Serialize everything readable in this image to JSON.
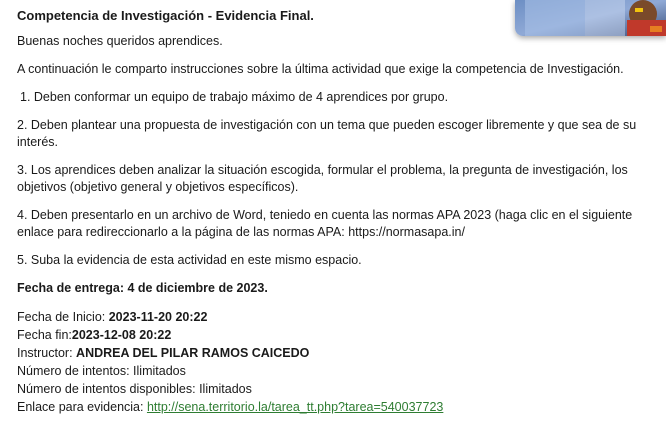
{
  "activity": {
    "title": "Competencia de Investigación - Evidencia Final.",
    "greeting": "Buenas noches queridos aprendices.",
    "intro": "A continuación le comparto instrucciones sobre la última actividad que exige la competencia de Investigación.",
    "instructions": [
      "1. Deben conformar un equipo de trabajo máximo de 4 aprendices por grupo.",
      "2. Deben plantear una propuesta de investigación con un tema que pueden escoger libremente y que sea de su interés.",
      "3. Los aprendices deben analizar la  situación escogida, formular el problema, la pregunta de investigación, los objetivos (objetivo general y objetivos específicos).",
      "4. Deben presentarlo en un archivo de Word, teniedo en cuenta las normas APA 2023 (haga clic en el siguiente enlace para redireccionarlo a la página de las normas APA: https://normasapa.in/",
      "5. Suba la evidencia de esta actividad en este mismo espacio."
    ],
    "due_date": "Fecha de entrega: 4 de diciembre de 2023."
  },
  "meta": {
    "start_label": "Fecha de Inicio: ",
    "start_value": "2023-11-20 20:22",
    "end_label": "Fecha fin:",
    "end_value": "2023-12-08 20:22",
    "instructor_label": "Instructor: ",
    "instructor_value": "ANDREA DEL PILAR RAMOS CAICEDO",
    "attempts_label": "Número de intentos: ",
    "attempts_value": "Ilimitados",
    "attempts_available_label": "Número de intentos disponibles: ",
    "attempts_available_value": "Ilimitados",
    "evidence_label": "Enlace para evidencia: ",
    "evidence_link": "http://sena.territorio.la/tarea_tt.php?tarea=540037723"
  },
  "colors": {
    "link": "#2e7d32",
    "text": "#1a1a1a"
  }
}
